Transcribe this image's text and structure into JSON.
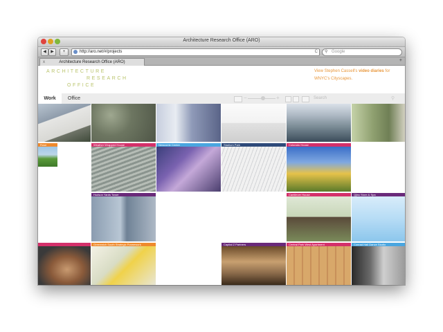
{
  "window": {
    "title": "Architecture Research Office (ARO)"
  },
  "toolbar": {
    "back_label": "◀",
    "forward_label": "▶",
    "add_label": "+",
    "url": "http://aro.net/#/projects",
    "reload_label": "C",
    "search_icon": "magnifier-icon",
    "search_placeholder": "Google"
  },
  "tabbar": {
    "tab_title": "Architecture Research Office (ARO)",
    "close_label": "x",
    "add_label": "+"
  },
  "header": {
    "logo": [
      "ARCHITECTURE",
      "RESEARCH",
      "OFFICE"
    ],
    "promo_before": "View Stephen Cassell's ",
    "promo_link": "video diaries",
    "promo_after": " for WNYC's Cityscapes."
  },
  "nav": {
    "tabs": [
      {
        "label": "Work"
      },
      {
        "label": "Office"
      }
    ],
    "search_placeholder": "Search"
  },
  "colors": {
    "pink": "#d4306a",
    "blue": "#4aa6e0",
    "navy": "#2e4a7a",
    "orange": "#ef8a2d",
    "purple": "#6a2a7a",
    "logo": "#b9c36a",
    "promo": "#e8963a"
  },
  "tiles": [
    {
      "label": "",
      "color": ""
    },
    {
      "label": "",
      "color": ""
    },
    {
      "label": "",
      "color": ""
    },
    {
      "label": "",
      "color": ""
    },
    {
      "label": "",
      "color": ""
    },
    {
      "label": "",
      "color": ""
    },
    {
      "label": "Rose",
      "color": "orange"
    },
    {
      "label": "Weather Wrapped House",
      "color": "pink"
    },
    {
      "label": "Newcomb Center",
      "color": "blue"
    },
    {
      "label": "Stadium Park",
      "color": "navy"
    },
    {
      "label": "Colorado House",
      "color": "pink"
    },
    {
      "label": "Hudson Yards Tower",
      "color": "purple"
    },
    {
      "label": "Cantilever House",
      "color": "pink"
    },
    {
      "label": "Qjiss Store & Spa",
      "color": "purple"
    },
    {
      "label": "",
      "color": "pink"
    },
    {
      "label": "Greenwich South Strategic Framework",
      "color": "orange"
    },
    {
      "label": "Capital Z Partners",
      "color": "purple"
    },
    {
      "label": "Central Park West Apartment",
      "color": "pink"
    },
    {
      "label": "Conrad Hall Dance Studio",
      "color": "blue"
    }
  ]
}
